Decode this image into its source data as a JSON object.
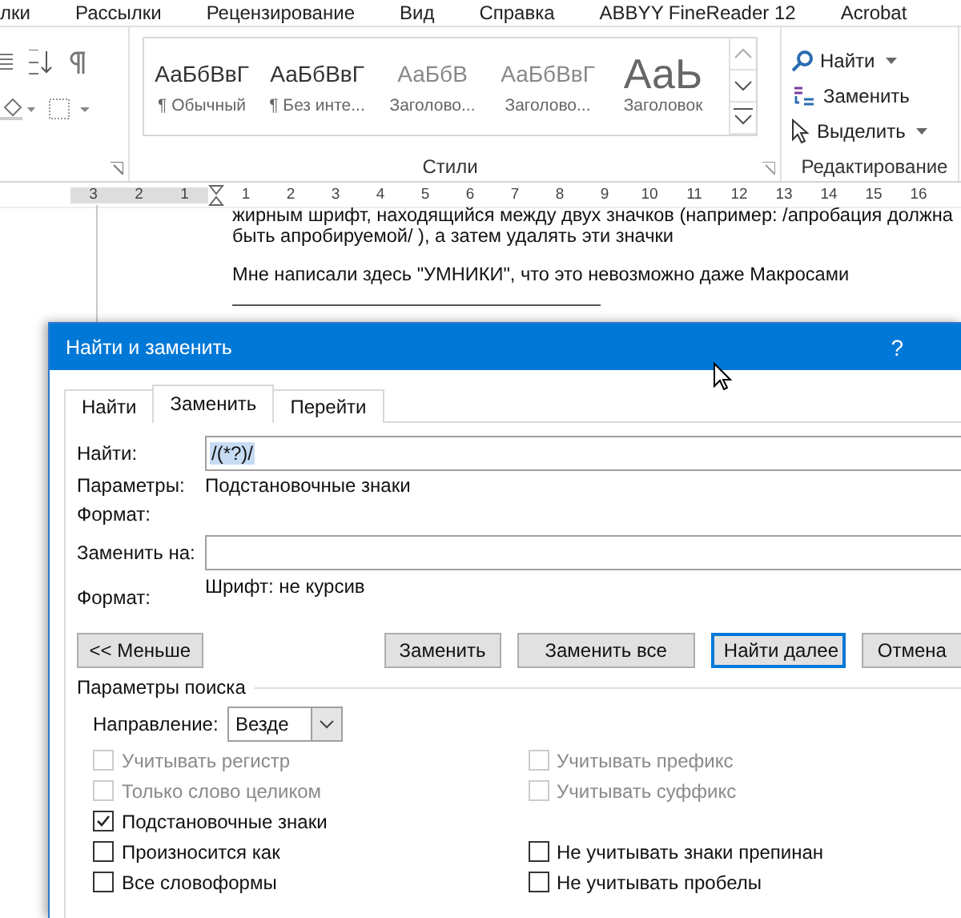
{
  "menu_bar": {
    "items": [
      {
        "label": "лки"
      },
      {
        "label": "Рассылки"
      },
      {
        "label": "Рецензирование"
      },
      {
        "label": "Вид"
      },
      {
        "label": "Справка"
      },
      {
        "label": "ABBYY FineReader 12"
      },
      {
        "label": "Acrobat"
      }
    ]
  },
  "ribbon": {
    "styles": {
      "items": [
        {
          "sample": "АаБбВвГ",
          "name": "¶ Обычный",
          "kind": "normal"
        },
        {
          "sample": "АаБбВвГ",
          "name": "¶ Без инте...",
          "kind": "normal"
        },
        {
          "sample": "АаБбВ",
          "name": "Заголово...",
          "kind": "faded"
        },
        {
          "sample": "АаБбВвГ",
          "name": "Заголово...",
          "kind": "faded"
        },
        {
          "sample": "АаЬ",
          "name": "Заголовок",
          "kind": "large"
        }
      ],
      "label": "Стили"
    },
    "editing": {
      "items": [
        {
          "label": "Найти",
          "kind": "find",
          "has_dropdown": true
        },
        {
          "label": "Заменить",
          "kind": "replace",
          "has_dropdown": false
        },
        {
          "label": "Выделить",
          "kind": "select",
          "has_dropdown": true
        }
      ],
      "label": "Редактирование"
    }
  },
  "ruler": {
    "left_labels": [
      "3",
      "2",
      "1"
    ],
    "right_labels": [
      "1",
      "2",
      "3",
      "4",
      "5",
      "6",
      "7",
      "8",
      "9",
      "10",
      "11",
      "12",
      "13",
      "14",
      "15",
      "16"
    ]
  },
  "document": {
    "lines": [
      "жирным шрифт, находящийся между двух значков (например: /апробация должна",
      "быть апробируемой/ ), а затем удалять эти значки",
      "Мне написали здесь \"УМНИКИ\", что это невозможно даже Макросами"
    ]
  },
  "dialog": {
    "title": "Найти и заменить",
    "help": "?",
    "tabs": [
      {
        "label": "Найти",
        "selected": false
      },
      {
        "label": "Заменить",
        "selected": true
      },
      {
        "label": "Перейти",
        "selected": false
      }
    ],
    "find": {
      "label": "Найти:",
      "value": "/(*?)/"
    },
    "find_options": {
      "label": "Параметры:",
      "value": "Подстановочные знаки"
    },
    "find_format": {
      "label": "Формат:"
    },
    "replace": {
      "label": "Заменить на:"
    },
    "replace_format": {
      "label": "Формат:",
      "value": "Шрифт: не курсив"
    },
    "buttons": [
      {
        "label": "<< Меньше",
        "kind": "toggle"
      },
      {
        "label": "Заменить",
        "kind": "normal"
      },
      {
        "label": "Заменить все",
        "kind": "normal"
      },
      {
        "label": "Найти далее",
        "kind": "default"
      },
      {
        "label": "Отмена",
        "kind": "normal"
      }
    ],
    "search_options": {
      "title": "Параметры поиска",
      "direction": {
        "label": "Направление:",
        "value": "Везде"
      },
      "rows": [
        {
          "left": {
            "label": "Учитывать регистр",
            "checked": false,
            "disabled": true
          },
          "right": {
            "label": "Учитывать префикс",
            "checked": false,
            "disabled": true
          }
        },
        {
          "left": {
            "label": "Только слово целиком",
            "checked": false,
            "disabled": true
          },
          "right": {
            "label": "Учитывать суффикс",
            "checked": false,
            "disabled": true
          }
        },
        {
          "left": {
            "label": "Подстановочные знаки",
            "checked": true,
            "disabled": false
          }
        },
        {
          "left": {
            "label": "Произносится как",
            "checked": false,
            "disabled": false
          },
          "right": {
            "label": "Не учитывать знаки препинан",
            "checked": false,
            "disabled": false
          }
        },
        {
          "left": {
            "label": "Все словоформы",
            "checked": false,
            "disabled": false
          },
          "right": {
            "label": "Не учитывать пробелы",
            "checked": false,
            "disabled": false
          }
        }
      ]
    }
  }
}
